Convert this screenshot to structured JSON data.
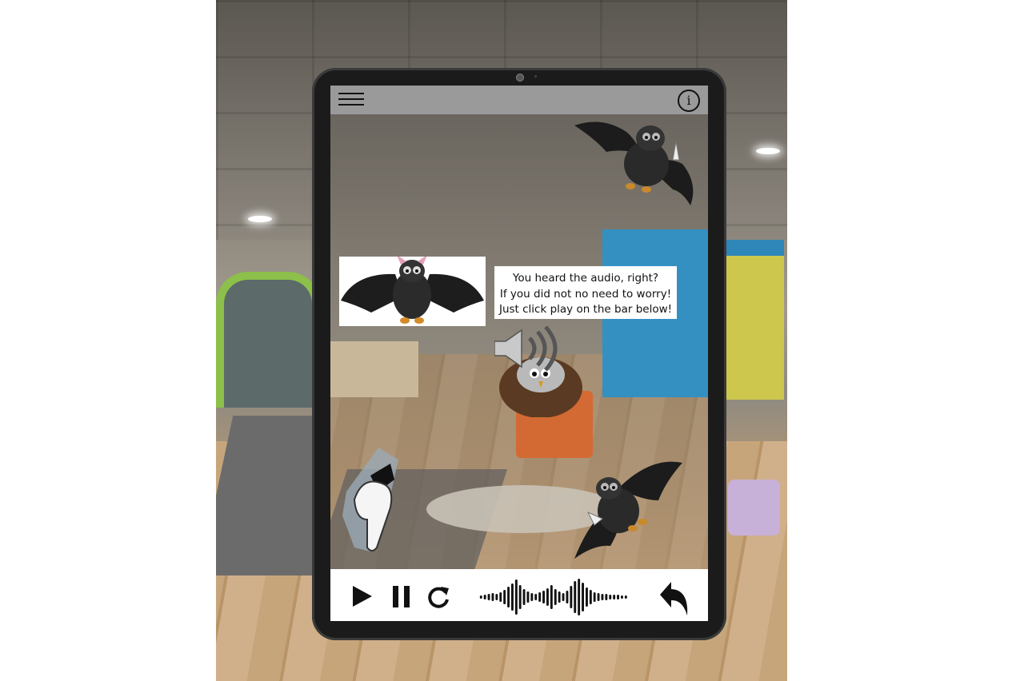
{
  "toolbar": {
    "menu_icon": "hamburger-menu-icon",
    "info_icon": "info-icon",
    "info_glyph": "i"
  },
  "speech": {
    "lines": [
      "You heard the audio, right?",
      "If you did not no need to worry!",
      "Just click play on the bar below!"
    ]
  },
  "player": {
    "icons": [
      "play-icon",
      "pause-icon",
      "replay-icon",
      "audio-waveform-icon",
      "back-arrow-icon"
    ]
  },
  "colors": {
    "bar_gray": "#9a9a9a",
    "tablet_frame": "#1b1b1b",
    "player_bg": "#ffffff",
    "icon_black": "#111111"
  }
}
